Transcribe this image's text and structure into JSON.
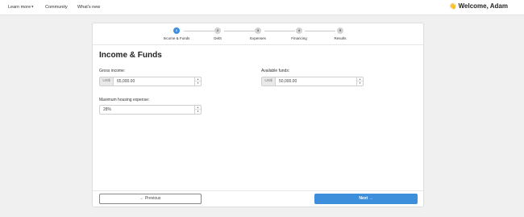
{
  "nav": {
    "learn_more": "Learn more",
    "community": "Community",
    "whats_new": "What's new",
    "welcome": "Welcome, Adam",
    "wave_emoji": "👋"
  },
  "stepper": {
    "steps": [
      {
        "number": "1",
        "label": "Income & Funds",
        "active": true
      },
      {
        "number": "2",
        "label": "Debt",
        "active": false
      },
      {
        "number": "3",
        "label": "Expenses",
        "active": false
      },
      {
        "number": "4",
        "label": "Financing",
        "active": false
      },
      {
        "number": "5",
        "label": "Results",
        "active": false
      }
    ]
  },
  "form": {
    "title": "Income & Funds",
    "gross_income": {
      "label": "Gross income:",
      "prefix": "US$",
      "value": "65,000.00"
    },
    "available_funds": {
      "label": "Available funds:",
      "prefix": "US$",
      "value": "50,000.00"
    },
    "max_housing": {
      "label": "Maximum housing expense:",
      "value": "28%"
    }
  },
  "footer": {
    "previous_label": "Previous",
    "next_label": "Next",
    "previous_arrow": "←",
    "next_arrow": "→"
  },
  "colors": {
    "accent": "#3d8fdc",
    "page_bg": "#f0f0f0"
  },
  "icons": {
    "chevron": "chevron-down-icon",
    "spin_up": "spin-up-icon",
    "spin_down": "spin-down-icon",
    "arrow_left": "arrow-left-icon",
    "arrow_right": "arrow-right-icon"
  }
}
